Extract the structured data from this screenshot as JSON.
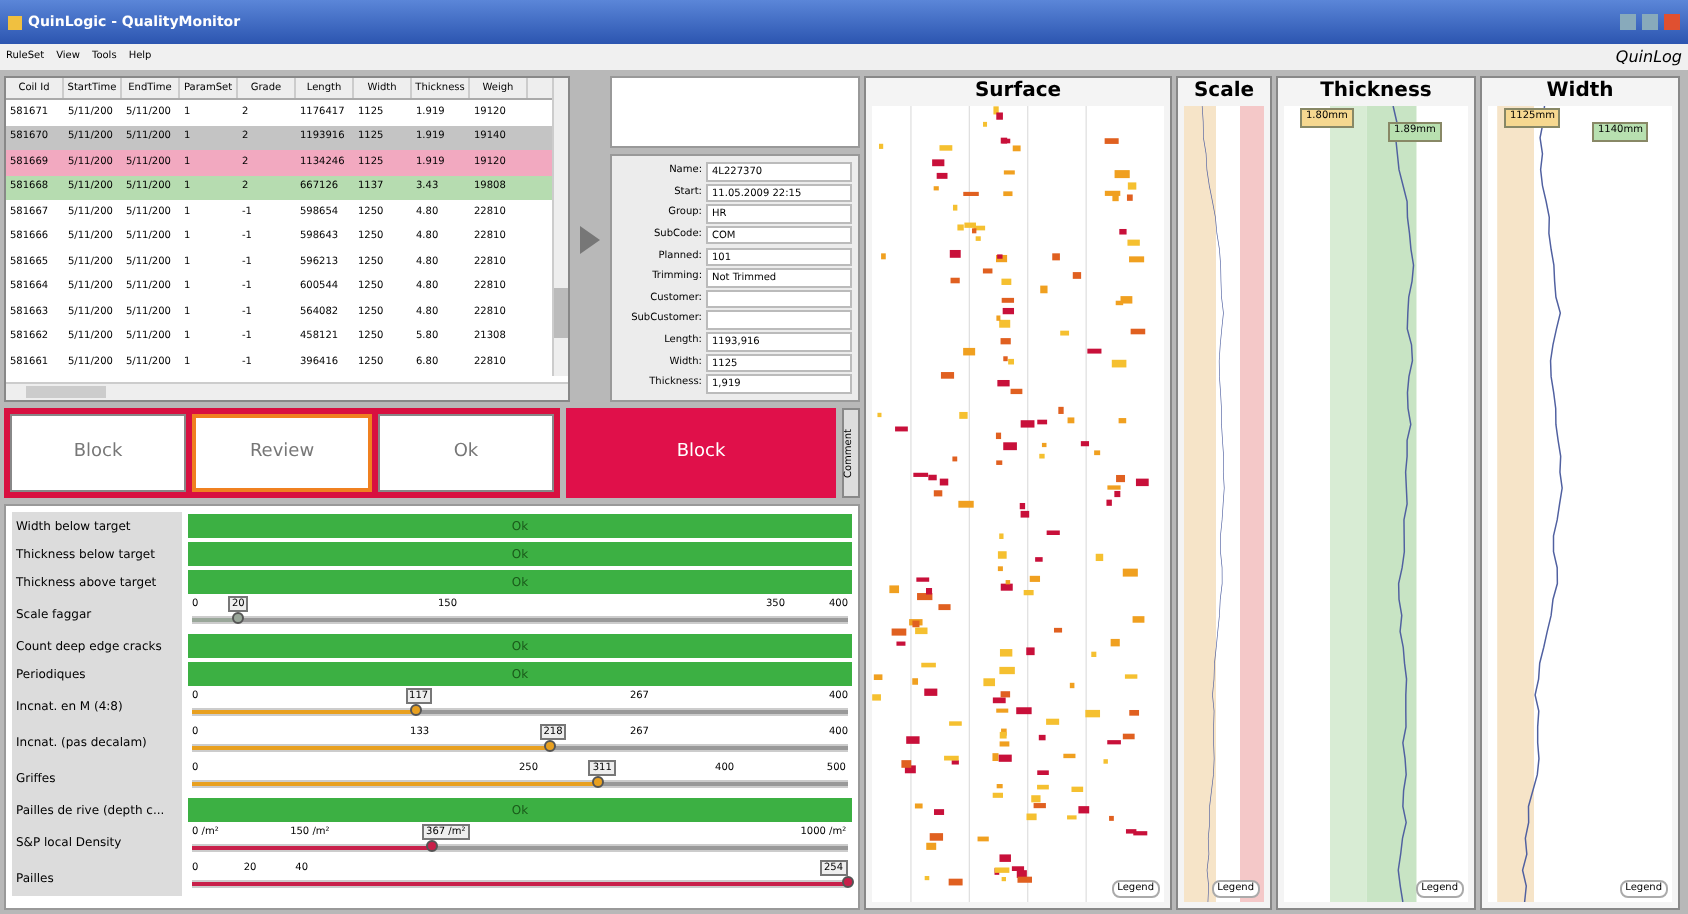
{
  "window": {
    "title": "QuinLogic - QualityMonitor",
    "logo": "QuinLog"
  },
  "menu": [
    "RuleSet",
    "View",
    "Tools",
    "Help"
  ],
  "table": {
    "columns": [
      "Coil Id",
      "StartTime",
      "EndTime",
      "ParamSet",
      "Grade",
      "Length",
      "Width",
      "Thickness",
      "Weigh"
    ],
    "rows": [
      {
        "cells": [
          "581671",
          "5/11/200",
          "5/11/200",
          "1",
          "2",
          "1176417",
          "1125",
          "1.919",
          "19120"
        ],
        "selected": false
      },
      {
        "cells": [
          "581670",
          "5/11/200",
          "5/11/200",
          "1",
          "2",
          "1193916",
          "1125",
          "1.919",
          "19140"
        ],
        "selected": true
      },
      {
        "cells": [
          "581669",
          "5/11/200",
          "5/11/200",
          "1",
          "2",
          "1134246",
          "1125",
          "1.919",
          "19120"
        ],
        "selected": false,
        "color": "#f2a9c0"
      },
      {
        "cells": [
          "581668",
          "5/11/200",
          "5/11/200",
          "1",
          "2",
          "667126",
          "1137",
          "3.43",
          "19808"
        ],
        "selected": false,
        "color": "#b6dcb0"
      },
      {
        "cells": [
          "581667",
          "5/11/200",
          "5/11/200",
          "1",
          "-1",
          "598654",
          "1250",
          "4.80",
          "22810"
        ],
        "selected": false
      },
      {
        "cells": [
          "581666",
          "5/11/200",
          "5/11/200",
          "1",
          "-1",
          "598643",
          "1250",
          "4.80",
          "22810"
        ],
        "selected": false
      },
      {
        "cells": [
          "581665",
          "5/11/200",
          "5/11/200",
          "1",
          "-1",
          "596213",
          "1250",
          "4.80",
          "22810"
        ],
        "selected": false
      },
      {
        "cells": [
          "581664",
          "5/11/200",
          "5/11/200",
          "1",
          "-1",
          "600544",
          "1250",
          "4.80",
          "22810"
        ],
        "selected": false
      },
      {
        "cells": [
          "581663",
          "5/11/200",
          "5/11/200",
          "1",
          "-1",
          "564082",
          "1250",
          "4.80",
          "22810"
        ],
        "selected": false
      },
      {
        "cells": [
          "581662",
          "5/11/200",
          "5/11/200",
          "1",
          "-1",
          "458121",
          "1250",
          "5.80",
          "21308"
        ],
        "selected": false
      },
      {
        "cells": [
          "581661",
          "5/11/200",
          "5/11/200",
          "1",
          "-1",
          "396416",
          "1250",
          "6.80",
          "22810"
        ],
        "selected": false
      }
    ]
  },
  "details": [
    {
      "label": "Name:",
      "value": "4L227370"
    },
    {
      "label": "Start:",
      "value": "11.05.2009 22:15"
    },
    {
      "label": "Group:",
      "value": "HR"
    },
    {
      "label": "SubCode:",
      "value": "COM"
    },
    {
      "label": "Planned:",
      "value": "101"
    },
    {
      "label": "Trimming:",
      "value": "Not Trimmed"
    },
    {
      "label": "Customer:"
    },
    {
      "label": "SubCustomer:"
    },
    {
      "label": "Length:",
      "value": "1193,916"
    },
    {
      "label": "Width:",
      "value": "1125"
    },
    {
      "label": "Thickness:",
      "value": "1,919"
    }
  ],
  "decision": {
    "options": [
      {
        "label": "Block",
        "selected": false
      },
      {
        "label": "Review",
        "selected": true
      },
      {
        "label": "Ok",
        "selected": false
      }
    ],
    "result": "Block",
    "comment": "Comment"
  },
  "rules": [
    {
      "kind": "status",
      "name": "Width below target",
      "status": "Ok"
    },
    {
      "kind": "status",
      "name": "Thickness below target",
      "status": "Ok"
    },
    {
      "kind": "status",
      "name": "Thickness above target",
      "status": "Ok"
    },
    {
      "kind": "slider",
      "name": "Scale faggar",
      "color": "#9aa79a",
      "level": 0.07,
      "reading": "20",
      "ticks": [
        "0",
        "150",
        "350",
        "400"
      ]
    },
    {
      "kind": "status",
      "name": "Count deep edge cracks",
      "status": "Ok"
    },
    {
      "kind": "status",
      "name": "Periodiques",
      "status": "Ok"
    },
    {
      "kind": "slider",
      "name": "Incnat. en M (4:8)",
      "color": "#e8a020",
      "level": 0.34,
      "reading": "117",
      "ticks": [
        "0",
        "267",
        "400"
      ]
    },
    {
      "kind": "slider",
      "name": "Incnat. (pas decalam)",
      "color": "#e8a020",
      "level": 0.545,
      "reading": "218",
      "ticks": [
        "0",
        "133",
        "267",
        "400"
      ]
    },
    {
      "kind": "slider",
      "name": "Griffes",
      "color": "#e8a020",
      "level": 0.62,
      "reading": "311",
      "ticks": [
        "0",
        "250",
        "400",
        "500"
      ]
    },
    {
      "kind": "status",
      "name": "Pailles de rive (depth c...",
      "status": "Ok"
    },
    {
      "kind": "slider",
      "name": "S&P local Density",
      "color": "#c8204a",
      "level": 0.366,
      "reading": "367 /m²",
      "ticks": [
        "0 /m²",
        "150 /m²",
        "1000 /m²"
      ]
    },
    {
      "kind": "slider",
      "name": "Pailles",
      "color": "#c8204a",
      "level": 1,
      "reading": "254",
      "ticks": [
        "0",
        "20",
        "40"
      ]
    }
  ],
  "charts": [
    {
      "kind": "surface",
      "title": "Surface",
      "legend": "Legend"
    },
    {
      "kind": "scale",
      "title": "Scale",
      "legend": "Legend"
    },
    {
      "kind": "thickness",
      "title": "Thickness",
      "labels": [
        "1.80mm",
        "1.89mm"
      ],
      "legend": "Legend"
    },
    {
      "kind": "width",
      "title": "Width",
      "labels": [
        "1125mm",
        "1140mm"
      ],
      "legend": "Legend"
    }
  ]
}
